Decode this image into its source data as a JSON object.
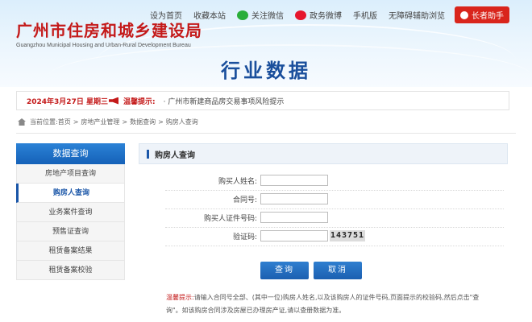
{
  "header": {
    "logo_cn": "广州市住房和城乡建设局",
    "logo_en": "Guangzhou Municipal Housing and Urban-Rural Development Bureau",
    "page_title": "行业数据",
    "nav": {
      "homepage": "设为首页",
      "favorite": "收藏本站",
      "wechat": "关注微信",
      "weibo": "政务微博",
      "mobile": "手机版",
      "accessible": "无障碍辅助浏览",
      "elder": "长者助手"
    }
  },
  "notice": {
    "date": "2024年3月27日 星期三",
    "tip_label": "温馨提示:",
    "tip_text": "· 广州市新建商品房交易事项风险提示"
  },
  "breadcrumb": {
    "prefix": "当前位置:",
    "items": [
      "首页",
      "房地产业管理",
      "数据查询",
      "购房人查询"
    ]
  },
  "sidebar": {
    "title": "数据查询",
    "items": [
      {
        "label": "房地产项目查询"
      },
      {
        "label": "购房人查询"
      },
      {
        "label": "业务案件查询"
      },
      {
        "label": "预售证查询"
      },
      {
        "label": "租赁备案结果"
      },
      {
        "label": "租赁备案校验"
      }
    ],
    "active_index": 1
  },
  "panel": {
    "title": "购房人查询"
  },
  "form": {
    "buyer_name": {
      "label": "购买人姓名:",
      "value": ""
    },
    "contract_no": {
      "label": "合同号:",
      "value": ""
    },
    "id_no": {
      "label": "购买人证件号码:",
      "value": ""
    },
    "captcha": {
      "label": "验证码:",
      "value": "",
      "code": "143751"
    }
  },
  "buttons": {
    "search": "查询",
    "cancel": "取消"
  },
  "hint": {
    "label": "温馨提示:",
    "text": "请输入合同号全部、(其中一位)购房人姓名,以及该购房人的证件号码,页面提示的校验码,然后点击\"查询\"。如该购房合同涉及房屋已办理房产证,请以查册数据为准。"
  }
}
